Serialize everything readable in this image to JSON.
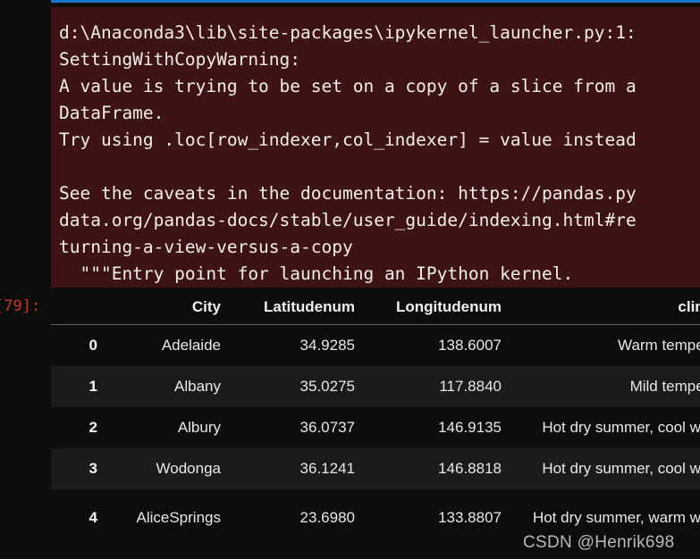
{
  "notebook": {
    "output_prompt": "[79]:",
    "accent_blue": "#1976c8",
    "stderr_bg": "#3d1413",
    "background": "#0d0d0d"
  },
  "warning": {
    "lines": [
      "d:\\Anaconda3\\lib\\site-packages\\ipykernel_launcher.py:1:",
      "SettingWithCopyWarning:",
      "A value is trying to be set on a copy of a slice from a",
      "DataFrame.",
      "Try using .loc[row_indexer,col_indexer] = value instead",
      "",
      "See the caveats in the documentation: https://pandas.py",
      "data.org/pandas-docs/stable/user_guide/indexing.html#re",
      "turning-a-view-versus-a-copy",
      "  \"\"\"Entry point for launching an IPython kernel."
    ]
  },
  "dataframe": {
    "columns": [
      "",
      "City",
      "Latitudenum",
      "Longitudenum",
      "climate"
    ],
    "rows": [
      {
        "index": "0",
        "City": "Adelaide",
        "Latitudenum": "34.9285",
        "Longitudenum": "138.6007",
        "climate": "Warm temperate"
      },
      {
        "index": "1",
        "City": "Albany",
        "Latitudenum": "35.0275",
        "Longitudenum": "117.8840",
        "climate": "Mild temperate"
      },
      {
        "index": "2",
        "City": "Albury",
        "Latitudenum": "36.0737",
        "Longitudenum": "146.9135",
        "climate": "Hot dry summer, cool winter"
      },
      {
        "index": "3",
        "City": "Wodonga",
        "Latitudenum": "36.1241",
        "Longitudenum": "146.8818",
        "climate": "Hot dry summer, cool winter"
      },
      {
        "index": "4",
        "City": "AliceSprings",
        "Latitudenum": "23.6980",
        "Longitudenum": "133.8807",
        "climate": "Hot dry summer, warm winter"
      }
    ]
  },
  "watermark": {
    "text": "CSDN @Henrik698"
  }
}
